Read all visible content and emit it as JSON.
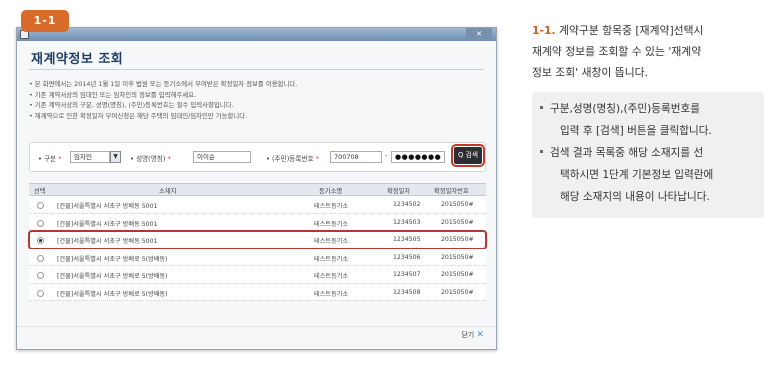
{
  "badge": "1-1",
  "dialog": {
    "title": "재계약정보 조회",
    "close_x": "×",
    "notices": [
      "• 본 화면에서는 2014년 1월 1일 이후 법원 또는 등기소에서 부여받은 확정일자 정보를 이용합니다.",
      "• 기존 계약서상의 임대인 또는 임차인의 정보를 입력해주세요.",
      "• 기존 계약서상의 구분, 성명(명칭), (주민)등록번호는 필수 입력사항입니다.",
      "• 재계약으로 인한 확정일자 부여신청은 해당 주택의 임대인/임차인만 가능합니다."
    ],
    "search": {
      "type_label": "• 구분",
      "type_value": "임차인",
      "name_label": "• 성명(명칭)",
      "name_value": "이이순",
      "regno_label": "• (주민)등록번호",
      "regno_front": "700708",
      "regno_dash": "-",
      "regno_back": "●●●●●●●",
      "required_mark": "*",
      "search_button": "Q 검색",
      "dropdown_arrow": "▼"
    },
    "table": {
      "headers": [
        "선택",
        "소재지",
        "등기소명",
        "확정일자",
        "확정일자번호"
      ],
      "rows": [
        {
          "address": "[건물]서울특별시 서초구 방배동 5001",
          "office": "테스트등기소",
          "date": "1234502",
          "no": "2015050#",
          "selected": false
        },
        {
          "address": "[건물]서울특별시 서초구 방배동 5001",
          "office": "테스트등기소",
          "date": "1234503",
          "no": "2015050#",
          "selected": false
        },
        {
          "address": "[건물]서울특별시 서초구 방배동 5001",
          "office": "테스트등기소",
          "date": "1234505",
          "no": "2015050#",
          "selected": true
        },
        {
          "address": "[건물]서울특별시 서초구 방배로 5(방배동)",
          "office": "테스트등기소",
          "date": "1234506",
          "no": "2015050#",
          "selected": false
        },
        {
          "address": "[건물]서울특별시 서초구 방배로 5(방배동)",
          "office": "테스트등기소",
          "date": "1234507",
          "no": "2015050#",
          "selected": false
        },
        {
          "address": "[건물]서울특별시 서초구 방배로 5(방배동)",
          "office": "테스트등기소",
          "date": "1234508",
          "no": "2015050#",
          "selected": false
        }
      ]
    },
    "close_button": "닫기",
    "close_button_x": "✕"
  },
  "panel": {
    "step_number": "1-1.",
    "step_lines": [
      " 계약구분 항목중 [재계약]선택시",
      "재계약 정보를 조회할 수 있는 '재계약",
      "정보 조회' 새창이 뜹니다."
    ],
    "info_items": [
      {
        "lines": [
          "구분,성명(명칭),(주민)등록번호를",
          "입력 후 [검색] 버튼을 클릭합니다."
        ]
      },
      {
        "lines": [
          "검색 결과 목록중 해당 소재지를 선",
          "택하시면 1단계 기본정보 입력란에",
          "해당 소재지의 내용이 나타납니다."
        ]
      }
    ]
  },
  "colors": {
    "accent": "#d96b2a",
    "title": "#1f3f68",
    "highlight": "#b03a2e"
  }
}
